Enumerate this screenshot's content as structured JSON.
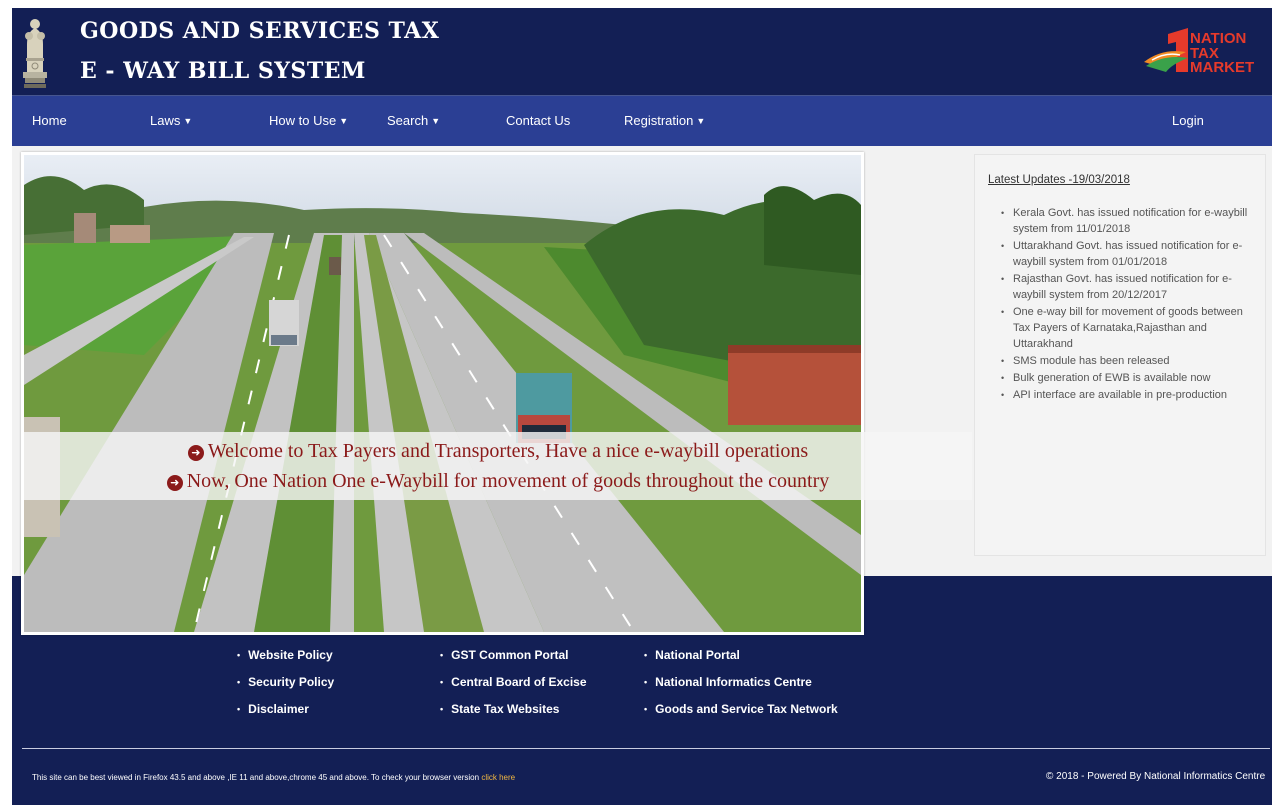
{
  "header": {
    "title_line1": "GOODS AND SERVICES TAX",
    "title_line2": "E - WAY BILL SYSTEM",
    "brand_logo_text": [
      "NATION",
      "TAX",
      "MARKET"
    ]
  },
  "nav": {
    "items": [
      {
        "label": "Home",
        "dropdown": false
      },
      {
        "label": "Laws",
        "dropdown": true
      },
      {
        "label": "How to Use",
        "dropdown": true
      },
      {
        "label": "Search",
        "dropdown": true
      },
      {
        "label": "Contact Us",
        "dropdown": false
      },
      {
        "label": "Registration",
        "dropdown": true
      }
    ],
    "login_label": "Login"
  },
  "banner": {
    "line1": "Welcome to Tax Payers and Transporters, Have a nice e-waybill operations",
    "line2": "Now, One Nation One e-Waybill for movement of goods throughout the country",
    "icon": "arrow-circle-right-icon"
  },
  "updates": {
    "title": "Latest Updates -19/03/2018",
    "items": [
      "Kerala Govt. has issued notification for e-waybill system from 11/01/2018",
      "Uttarakhand Govt. has issued notification for e-waybill system from 01/01/2018",
      "Rajasthan Govt. has issued notification for e-waybill system from 20/12/2017",
      "One e-way bill for movement of goods between Tax Payers of Karnataka,Rajasthan and Uttarakhand",
      "SMS module has been released",
      "Bulk generation of EWB is available now",
      "API interface are available in pre-production"
    ]
  },
  "footer": {
    "col1": [
      "Website Policy",
      "Security Policy",
      "Disclaimer"
    ],
    "col2": [
      "GST Common Portal",
      "Central Board of Excise",
      "State Tax Websites"
    ],
    "col3": [
      "National Portal",
      "National Informatics Centre",
      "Goods and Service Tax Network"
    ],
    "note": "This site can be best viewed in Firefox 43.5 and above ,IE 11 and above,chrome 45 and above. To check your browser version",
    "note_link": "click here",
    "copyright": "© 2018 - Powered By National Informatics Centre"
  },
  "colors": {
    "header_bg": "#131f55",
    "nav_bg": "#2b3f94",
    "banner_text": "#8b1a1a",
    "brand_red": "#e63a2b",
    "link_highlight": "#f4b942"
  }
}
